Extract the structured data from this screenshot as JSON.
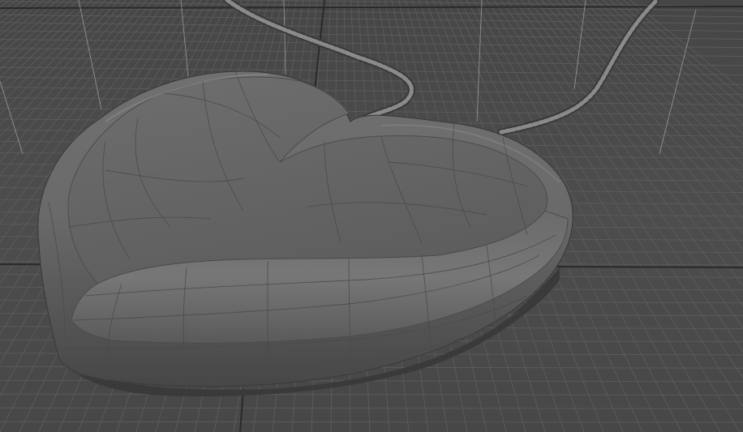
{
  "viewport": {
    "shading_mode": "wireframe-on-shaded",
    "grid": "on",
    "axes": "on"
  },
  "scene": {
    "objects": [
      {
        "name": "heart-pendant-mesh",
        "type": "heart-pendant"
      },
      {
        "name": "chain-mesh",
        "type": "chain"
      }
    ]
  },
  "colors": {
    "background": "#4a4a4a",
    "grid_minor": "#5a5a5a",
    "grid_major": "#2a2a2a",
    "mesh_light": "#7a7a7a",
    "mesh_mid": "#6a6a6a",
    "mesh_dark": "#3e3e3e",
    "wire": "#4a4a4a",
    "chain": "#8a8a8a"
  },
  "icons": [
    "grid-icon",
    "axis-line-icon",
    "heart-mesh-icon",
    "chain-icon"
  ]
}
